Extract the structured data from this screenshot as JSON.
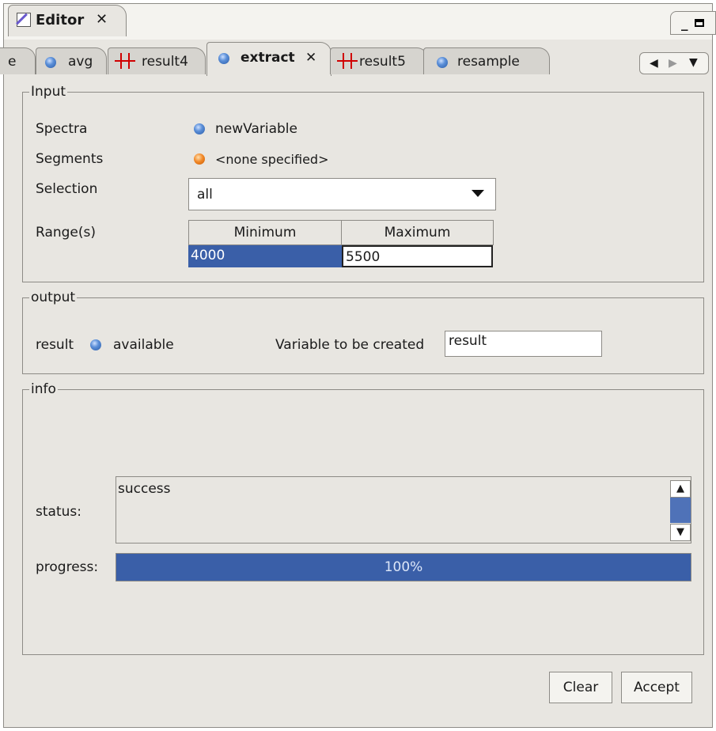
{
  "editor_tab": {
    "title": "Editor",
    "close": "✕"
  },
  "window_buttons": {
    "minimize": "_"
  },
  "tabs": [
    {
      "label": "e",
      "icon": "none",
      "active": false
    },
    {
      "label": "avg",
      "icon": "variable-dot-icon",
      "active": false
    },
    {
      "label": "result4",
      "icon": "spectrum-icon",
      "active": false
    },
    {
      "label": "extract",
      "icon": "variable-dot-icon",
      "active": true,
      "close": "✕"
    },
    {
      "label": "result5",
      "icon": "spectrum-icon",
      "active": false
    },
    {
      "label": "resample",
      "icon": "variable-dot-icon",
      "active": false
    }
  ],
  "tab_nav": {
    "left": "◀",
    "right": "▶",
    "menu": "▼"
  },
  "input": {
    "legend": "Input",
    "spectra_label": "Spectra",
    "spectra_value": "newVariable",
    "segments_label": "Segments",
    "segments_value": "<none specified>",
    "selection_label": "Selection",
    "selection_value": "all",
    "ranges_label": "Range(s)",
    "ranges_table": {
      "columns": [
        "Minimum",
        "Maximum"
      ],
      "rows": [
        [
          "4000",
          "5500"
        ]
      ]
    }
  },
  "output": {
    "legend": "output",
    "result_label": "result",
    "result_status": "available",
    "variable_label": "Variable to be created",
    "variable_value": "result"
  },
  "info": {
    "legend": "info",
    "status_label": "status:",
    "status_text": "success",
    "progress_label": "progress:",
    "progress_value": 100,
    "progress_text": "100%"
  },
  "buttons": {
    "clear": "Clear",
    "accept": "Accept"
  },
  "colors": {
    "panel_bg": "#e8e6e1",
    "accent_blue": "#3a5fa8",
    "selection_blue": "#3a5fa8",
    "spectrum_red": "#d00000",
    "status_orange": "#f28a2a"
  }
}
